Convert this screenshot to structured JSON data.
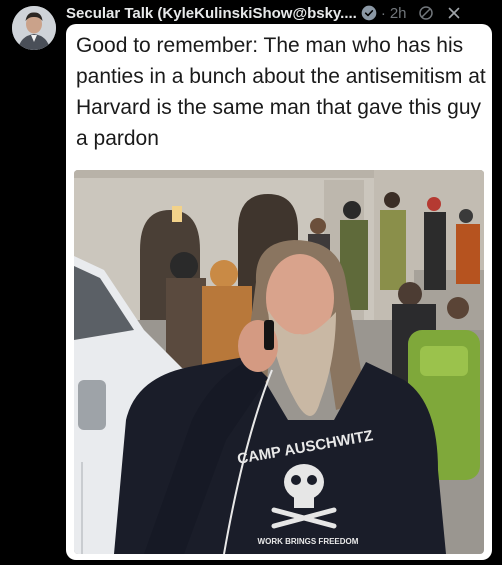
{
  "post": {
    "author": "Secular Talk (KyleKulinskiShow@bsky....",
    "time_prefix": "·",
    "time": "2h",
    "caption": "Good to remember: The man who has his panties in a bunch about the antisemitism at Harvard is the same man that gave this guy a pardon",
    "photo": {
      "hoodie_text_top": "CAMP AUSCHWITZ",
      "hoodie_text_bottom": "WORK BRINGS FREEDOM"
    }
  },
  "colors": {
    "background": "#000000",
    "verified_badge": "#8b98a5",
    "muted_text": "#71767b",
    "card_background": "#ffffff"
  },
  "icons": [
    "avatar",
    "verified-badge-icon",
    "no-sign-icon",
    "close-icon"
  ]
}
